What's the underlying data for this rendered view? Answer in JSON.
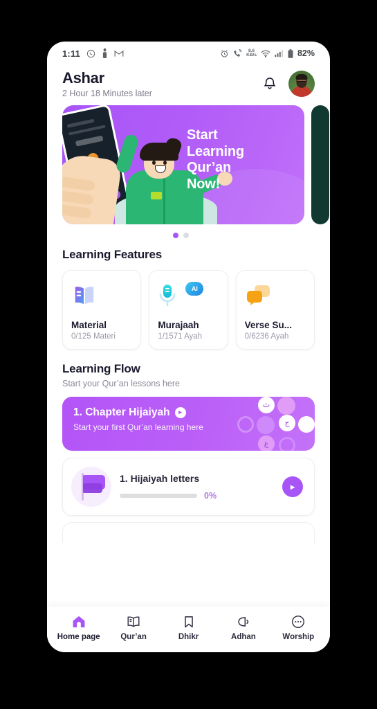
{
  "statusbar": {
    "time": "1:11",
    "left_icons": [
      "whatsapp-icon",
      "app-icon",
      "gmail-icon"
    ],
    "network_speed": "8.6",
    "network_speed_unit": "KB/s",
    "right_icons": [
      "alarm-icon",
      "call-icon",
      "wifi-icon",
      "signal-icon",
      "battery-icon"
    ],
    "battery": "82%"
  },
  "header": {
    "name": "Ashar",
    "subtitle": "2 Hour 18 Minutes later",
    "bell_icon": "bell-icon",
    "avatar_alt": "avatar"
  },
  "banner": {
    "title_line1": "Start",
    "title_line2": "Learning",
    "title_line3": "Qur’an",
    "title_line4": "Now!",
    "color": "#a855f7",
    "next_color": "#123832",
    "dots": [
      {
        "active": true
      },
      {
        "active": false
      }
    ]
  },
  "features": {
    "section_title": "Learning Features",
    "cards": [
      {
        "icon": "book-icon",
        "name": "Material",
        "meta": "0/125 Materi",
        "badge": ""
      },
      {
        "icon": "microphone-icon",
        "name": "Murajaah",
        "meta": "1/1571 Ayah",
        "badge": "AI"
      },
      {
        "icon": "chat-bubbles-icon",
        "name": "Verse Su...",
        "meta": "0/6236 Ayah",
        "badge": ""
      }
    ]
  },
  "flow": {
    "section_title": "Learning Flow",
    "section_sub": "Start your Qur’an lessons here",
    "chapter": {
      "title": "1. Chapter Hijaiyah",
      "subtitle": "Start your first Qur’an learning here",
      "arrow_icon": "chevron-right-icon",
      "letters": [
        "ث",
        "ج",
        "ع",
        "ث"
      ]
    },
    "lesson": {
      "icon": "flag-icon",
      "title": "1. Hijaiyah letters",
      "progress_percent": "0%",
      "progress_value": 0,
      "go_icon": "chevron-right-icon"
    }
  },
  "bottomnav": {
    "items": [
      {
        "icon": "home-icon",
        "label": "Home page",
        "active": true
      },
      {
        "icon": "quran-book-icon",
        "label": "Qur’an",
        "active": false
      },
      {
        "icon": "bookmark-icon",
        "label": "Dhikr",
        "active": false
      },
      {
        "icon": "speaker-icon",
        "label": "Adhan",
        "active": false
      },
      {
        "icon": "more-dots-icon",
        "label": "Worship",
        "active": false
      }
    ],
    "active_color": "#a855f7"
  }
}
